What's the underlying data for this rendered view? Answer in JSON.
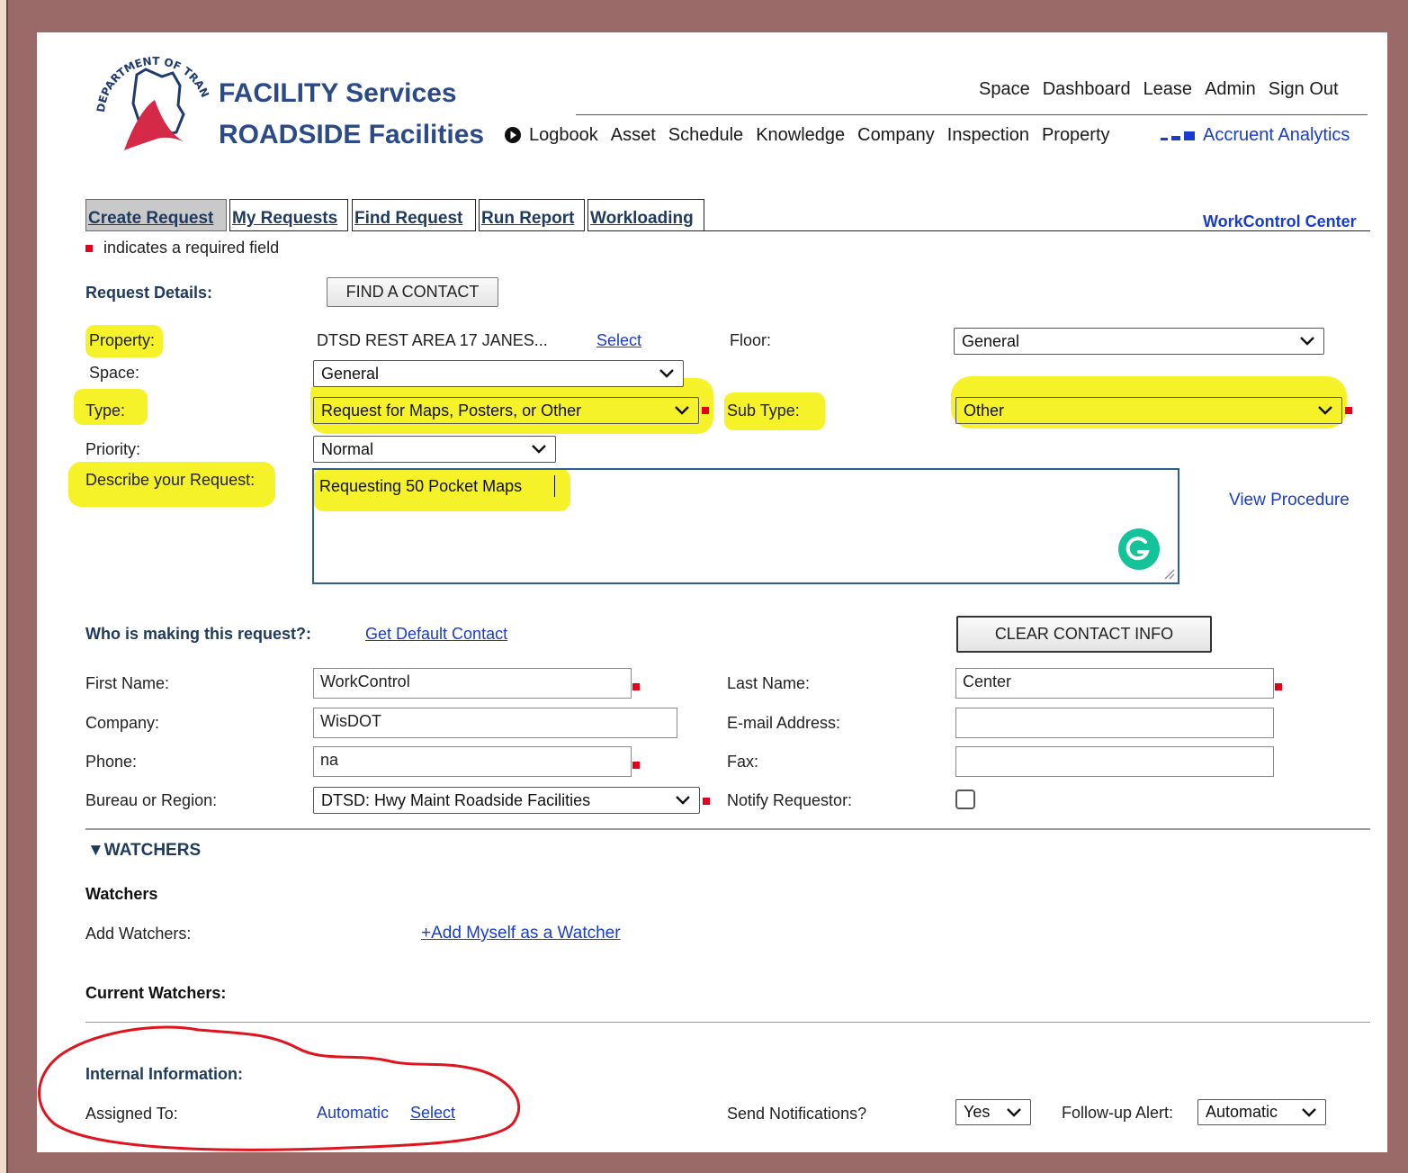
{
  "header": {
    "logo_text": "WISCONSIN DEPARTMENT OF TRANSPORTATION",
    "title_line1": "FACILITY Services",
    "title_line2": "ROADSIDE Facilities",
    "top_nav": [
      "Space",
      "Dashboard",
      "Lease",
      "Admin",
      "Sign Out"
    ],
    "main_nav": [
      "Logbook",
      "Asset",
      "Schedule",
      "Knowledge",
      "Company",
      "Inspection",
      "Property"
    ],
    "analytics_label": "Accruent Analytics"
  },
  "tabs": [
    "Create Request",
    "My Requests",
    "Find Request",
    "Run Report",
    "Workloading"
  ],
  "workcontrol_label": "WorkControl Center",
  "required_note": "indicates a required field",
  "request": {
    "section_label": "Request Details:",
    "find_contact_label": "FIND A CONTACT",
    "property_label": "Property:",
    "property_value": "DTSD REST AREA 17 JANES...",
    "property_select_link": "Select",
    "floor_label": "Floor:",
    "floor_value": "General",
    "space_label": "Space:",
    "space_value": "General",
    "type_label": "Type:",
    "type_value": "Request for Maps, Posters, or Other",
    "subtype_label": "Sub Type:",
    "subtype_value": "Other",
    "priority_label": "Priority:",
    "priority_value": "Normal",
    "describe_label": "Describe your Request:",
    "describe_value": "Requesting 50 Pocket Maps",
    "view_procedure": "View Procedure"
  },
  "contact": {
    "section_label": "Who is making this request?:",
    "default_contact_link": "Get Default Contact",
    "clear_label": "CLEAR CONTACT INFO",
    "first_name_label": "First Name:",
    "first_name_value": "WorkControl",
    "last_name_label": "Last Name:",
    "last_name_value": "Center",
    "company_label": "Company:",
    "company_value": "WisDOT",
    "email_label": "E-mail Address:",
    "email_value": "",
    "phone_label": "Phone:",
    "phone_value": "na",
    "fax_label": "Fax:",
    "fax_value": "",
    "bureau_label": "Bureau or Region:",
    "bureau_value": "DTSD: Hwy Maint Roadside Facilities",
    "notify_label": "Notify Requestor:"
  },
  "watchers": {
    "toggle_label": "▼WATCHERS",
    "heading": "Watchers",
    "add_label": "Add Watchers:",
    "add_myself_link": "+Add Myself as a Watcher",
    "current_label": "Current Watchers:"
  },
  "internal": {
    "section_label": "Internal Information:",
    "assigned_label": "Assigned To:",
    "assigned_value": "Automatic",
    "assigned_select_link": "Select",
    "send_notifications_label": "Send Notifications?",
    "send_notifications_value": "Yes",
    "followup_label": "Follow-up Alert:",
    "followup_value": "Automatic"
  },
  "colors": {
    "frame": "#9a6a68",
    "highlight": "#f6f22a",
    "required": "#e3001a",
    "link": "#1a3ccc",
    "section": "#1f3a5c",
    "annotation_circle": "#e0141e",
    "grammarly": "#15c39a"
  }
}
